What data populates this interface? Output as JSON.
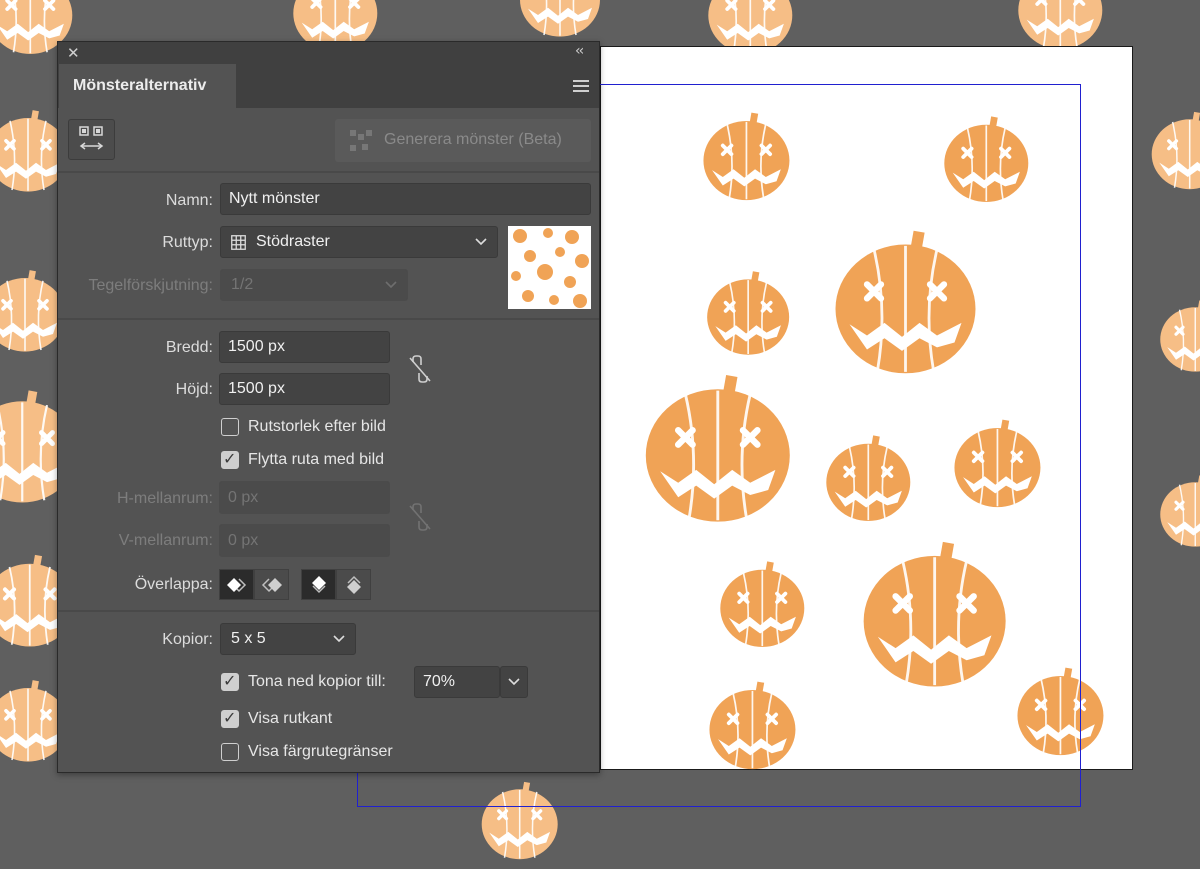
{
  "panel": {
    "title": "Mönsteralternativ",
    "generate_label": "Generera mönster (Beta)",
    "name_label": "Namn:",
    "name_value": "Nytt mönster",
    "tile_type_label": "Ruttyp:",
    "tile_type_value": "Stödraster",
    "brick_offset_label": "Tegelförskjutning:",
    "brick_offset_value": "1/2",
    "width_label": "Bredd:",
    "width_value": "1500 px",
    "height_label": "Höjd:",
    "height_value": "1500 px",
    "size_tile_to_art_label": "Rutstorlek efter bild",
    "size_tile_to_art_checked": false,
    "move_tile_with_art_label": "Flytta ruta med bild",
    "move_tile_with_art_checked": true,
    "h_spacing_label": "H-mellanrum:",
    "h_spacing_value": "0 px",
    "v_spacing_label": "V-mellanrum:",
    "v_spacing_value": "0 px",
    "overlap_label": "Överlappa:",
    "copies_label": "Kopior:",
    "copies_value": "5 x 5",
    "dim_copies_label": "Tona ned kopior till:",
    "dim_copies_checked": true,
    "dim_copies_value": "70%",
    "show_tile_edge_label": "Visa rutkant",
    "show_tile_edge_checked": true,
    "show_swatch_bounds_label": "Visa färgrutegränser",
    "show_swatch_bounds_checked": false
  },
  "colors": {
    "pumpkin_main": "#f0a356",
    "pumpkin_bg": "#f6be86",
    "tile_bound": "#2020d0",
    "panel_bg": "#535353"
  }
}
